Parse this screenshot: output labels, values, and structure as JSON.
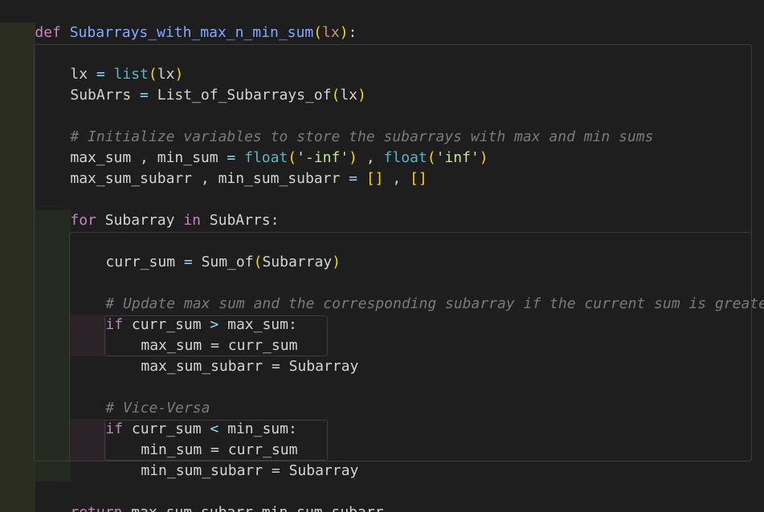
{
  "colors": {
    "background": "#1e1e1e",
    "keyword": "#c586c0",
    "function_name": "#82aaff",
    "builtin": "#56b6c2",
    "string": "#c3e88d",
    "comment": "#7a7a7a",
    "bracket": "#ffd700",
    "indent_guide_1": "#2a2e22",
    "indent_guide_2": "#253024",
    "indent_guide_3": "#2d2528"
  },
  "code": {
    "line1": {
      "kw": "def",
      "name": "Subarrays_with_max_n_min_sum",
      "open": "(",
      "param": "lx",
      "close": ")",
      "colon": ":"
    },
    "line2": {
      "var": "lx",
      "eq": " = ",
      "fn": "list",
      "open": "(",
      "arg": "lx",
      "close": ")"
    },
    "line3": {
      "var": "SubArrs",
      "eq": " = ",
      "fn": "List_of_Subarrays_of",
      "open": "(",
      "arg": "lx",
      "close": ")"
    },
    "line4": {
      "comment": "# Initialize variables to store the subarrays with max and min sums"
    },
    "line5": {
      "lhs": "max_sum , min_sum",
      "eq": " = ",
      "fn1": "float",
      "open1": "(",
      "str1": "'-inf'",
      "close1": ")",
      "sep": " , ",
      "fn2": "float",
      "open2": "(",
      "str2": "'inf'",
      "close2": ")"
    },
    "line6": {
      "lhs": "max_sum_subarr , min_sum_subarr",
      "eq": " = ",
      "l1": "[]",
      "sep": " , ",
      "l2": "[]"
    },
    "line7": {
      "kw1": "for",
      "var": " Subarray ",
      "kw2": "in",
      "rest": " SubArrs:"
    },
    "line8": {
      "var": "curr_sum",
      "eq": " = ",
      "fn": "Sum_of",
      "open": "(",
      "arg": "Subarray",
      "close": ")"
    },
    "line9": {
      "comment": "# Update max sum and the corresponding subarray if the current sum is greater"
    },
    "line10": {
      "kw": "if",
      "a": " curr_sum ",
      "op": ">",
      "b": " max_sum:"
    },
    "line11": {
      "text": "max_sum = curr_sum"
    },
    "line12": {
      "text": "max_sum_subarr = Subarray"
    },
    "line13": {
      "comment": "# Vice-Versa"
    },
    "line14": {
      "kw": "if",
      "a": " curr_sum ",
      "op": "<",
      "b": " min_sum:"
    },
    "line15": {
      "text": "min_sum = curr_sum"
    },
    "line16": {
      "text": "min_sum_subarr = Subarray"
    },
    "line17": {
      "kw": "return",
      "rest": " max_sum_subarr,min_sum_subarr"
    }
  }
}
